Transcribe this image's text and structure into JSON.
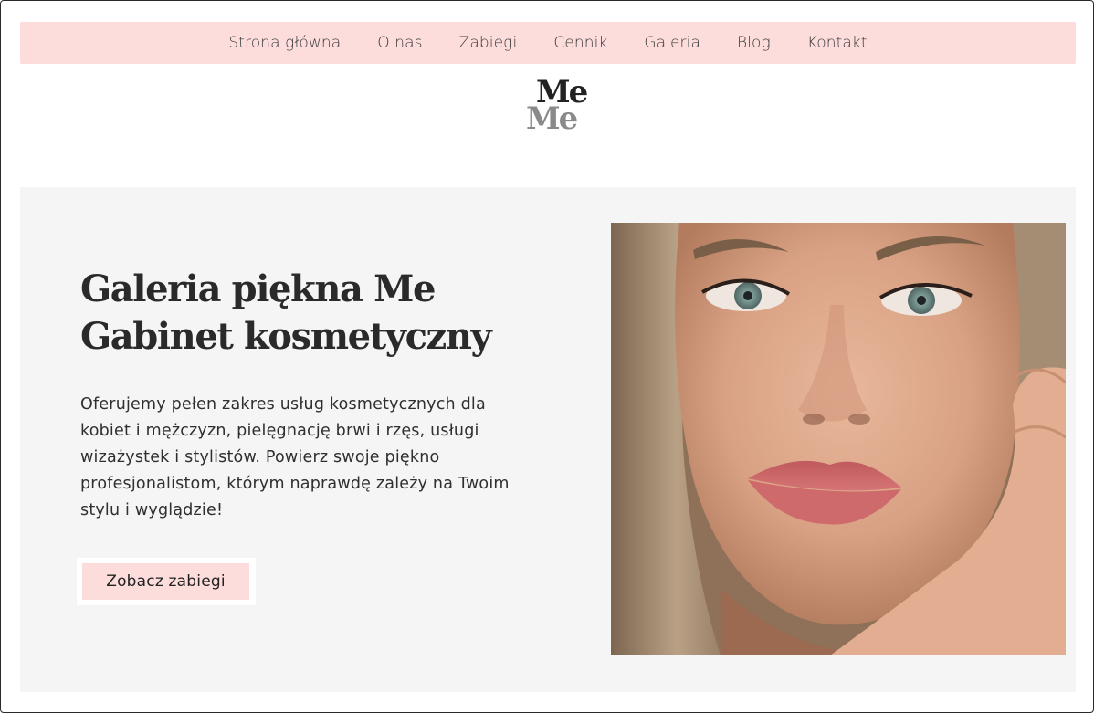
{
  "nav": {
    "items": [
      "Strona główna",
      "O nas",
      "Zabiegi",
      "Cennik",
      "Galeria",
      "Blog",
      "Kontakt"
    ]
  },
  "logo": {
    "line1": "Me",
    "line2": "Me"
  },
  "hero": {
    "title_line1": "Galeria piękna Me",
    "title_line2": "Gabinet kosmetyczny",
    "description": "Oferujemy pełen zakres usług kosmetycznych dla kobiet i mężczyzn, pielęgnację brwi i rzęs, usługi wizażystek i stylistów. Powierz swoje piękno profesjonalistom, którym naprawdę zależy na Twoim stylu i wyglądzie!",
    "button_label": "Zobacz zabiegi",
    "image_subject": "portrait-photo"
  },
  "colors": {
    "nav_background": "#fddcdc",
    "button_background": "#fddcdc",
    "hero_background": "#f5f5f5",
    "logo_dark": "#222222",
    "logo_gray": "#8a8a8a"
  }
}
